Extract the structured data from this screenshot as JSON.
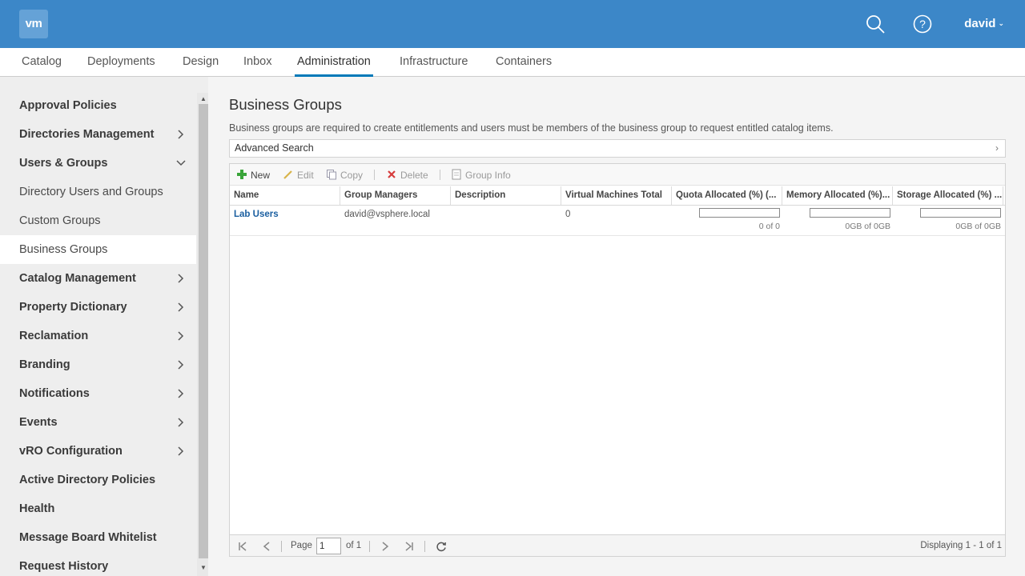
{
  "header": {
    "logo_text": "vm",
    "user": "david",
    "brand_color": "#3c87c8"
  },
  "tabs": [
    {
      "label": "Catalog"
    },
    {
      "label": "Deployments"
    },
    {
      "label": "Design"
    },
    {
      "label": "Inbox"
    },
    {
      "label": "Administration",
      "active": true
    },
    {
      "label": "Infrastructure"
    },
    {
      "label": "Containers"
    }
  ],
  "sidebar": {
    "items": [
      {
        "label": "Approval Policies",
        "type": "group"
      },
      {
        "label": "Directories Management",
        "type": "group",
        "icon": "chevron-right-icon"
      },
      {
        "label": "Users & Groups",
        "type": "group",
        "icon": "chevron-down-icon"
      },
      {
        "label": "Directory Users and Groups",
        "type": "child"
      },
      {
        "label": "Custom Groups",
        "type": "child"
      },
      {
        "label": "Business Groups",
        "type": "child",
        "selected": true
      },
      {
        "label": "Catalog Management",
        "type": "group",
        "icon": "chevron-right-icon"
      },
      {
        "label": "Property Dictionary",
        "type": "group",
        "icon": "chevron-right-icon"
      },
      {
        "label": "Reclamation",
        "type": "group",
        "icon": "chevron-right-icon"
      },
      {
        "label": "Branding",
        "type": "group",
        "icon": "chevron-right-icon"
      },
      {
        "label": "Notifications",
        "type": "group",
        "icon": "chevron-right-icon"
      },
      {
        "label": "Events",
        "type": "group",
        "icon": "chevron-right-icon"
      },
      {
        "label": "vRO Configuration",
        "type": "group",
        "icon": "chevron-right-icon"
      },
      {
        "label": "Active Directory Policies",
        "type": "group"
      },
      {
        "label": "Health",
        "type": "group"
      },
      {
        "label": "Message Board Whitelist",
        "type": "group"
      },
      {
        "label": "Request History",
        "type": "group"
      }
    ]
  },
  "main": {
    "title": "Business Groups",
    "description": "Business groups are required to create entitlements and users must be members of the business group to request entitled catalog items.",
    "advanced_search": "Advanced Search",
    "toolbar": {
      "new": "New",
      "edit": "Edit",
      "copy": "Copy",
      "delete": "Delete",
      "group_info": "Group Info"
    },
    "columns": [
      "Name",
      "Group Managers",
      "Description",
      "Virtual Machines Total",
      "Quota Allocated (%) (...",
      "Memory Allocated (%)...",
      "Storage Allocated (%) ..."
    ],
    "rows": [
      {
        "name": "Lab Users",
        "group_managers": "david@vsphere.local",
        "description": "",
        "vm_total": "0",
        "quota": {
          "fraction": 0,
          "text": "0 of 0"
        },
        "memory": {
          "fraction": 0,
          "text": "0GB of 0GB"
        },
        "storage": {
          "fraction": 0,
          "text": "0GB of 0GB"
        }
      }
    ],
    "pager": {
      "page_label": "Page",
      "page_value": "1",
      "of_label": "of 1",
      "displaying": "Displaying 1 - 1 of 1"
    }
  }
}
